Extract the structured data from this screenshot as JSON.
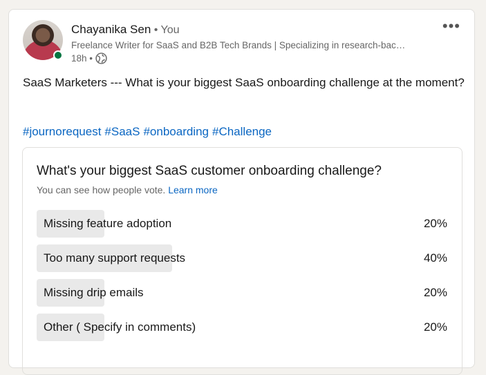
{
  "post": {
    "author_name": "Chayanika Sen",
    "author_relation": " • You",
    "headline": "Freelance Writer for SaaS and B2B Tech Brands | Specializing in research-bac…",
    "time": "18h •",
    "visibility_icon": "globe-icon",
    "more_icon": "•••",
    "text": "SaaS Marketers --- What is your biggest SaaS onboarding challenge at the moment?",
    "hashtags": [
      "#journorequest",
      "#SaaS",
      "#onboarding",
      "#Challenge"
    ]
  },
  "poll": {
    "question": "What's your biggest SaaS customer onboarding challenge?",
    "subtext": "You can see how people vote. ",
    "learn_more": "Learn more",
    "options": [
      {
        "label": "Missing feature adoption",
        "percent_text": "20%",
        "percent": 20
      },
      {
        "label": "Too many support requests",
        "percent_text": "40%",
        "percent": 40
      },
      {
        "label": "Missing drip emails",
        "percent_text": "20%",
        "percent": 20
      },
      {
        "label": "Other ( Specify in comments)",
        "percent_text": "20%",
        "percent": 20
      }
    ]
  },
  "colors": {
    "link": "#0a66c2",
    "presence": "#057642",
    "bar": "#e9e9e9"
  }
}
